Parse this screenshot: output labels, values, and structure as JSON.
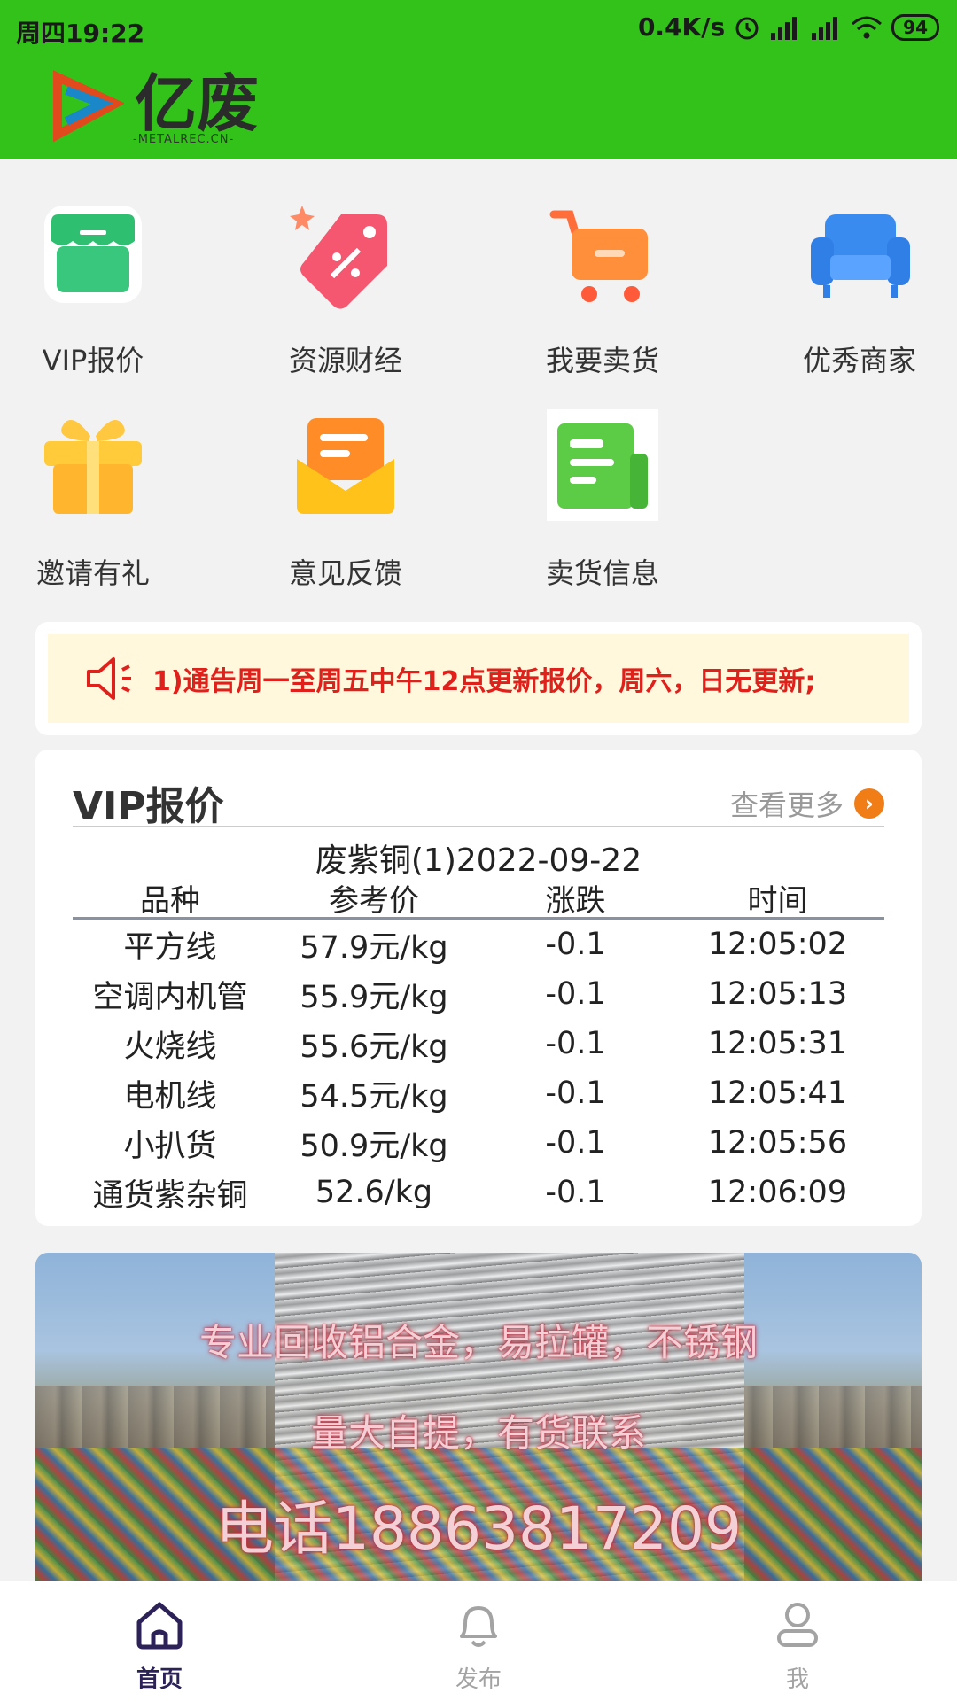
{
  "status_bar": {
    "time": "周四19:22",
    "network_speed": "0.4K/s",
    "battery": "94"
  },
  "header": {
    "brand": "亿废",
    "brand_sub": "-METALREC.CN-",
    "bg_color": "#33c21a"
  },
  "menu": [
    {
      "label": "VIP报价",
      "icon": "shop-icon"
    },
    {
      "label": "资源财经",
      "icon": "tag-icon"
    },
    {
      "label": "我要卖货",
      "icon": "cart-icon"
    },
    {
      "label": "优秀商家",
      "icon": "sofa-icon"
    },
    {
      "label": "邀请有礼",
      "icon": "gift-icon"
    },
    {
      "label": "意见反馈",
      "icon": "envelope-icon"
    },
    {
      "label": "卖货信息",
      "icon": "document-icon"
    }
  ],
  "notice": {
    "text": "1)通告周一至周五中午12点更新报价，周六，日无更新;",
    "icon": "speaker-icon"
  },
  "vip_quotes": {
    "title": "VIP报价",
    "more_label": "查看更多",
    "subtitle": "废紫铜(1)2022-09-22",
    "columns": [
      "品种",
      "参考价",
      "涨跌",
      "时间"
    ],
    "rows": [
      [
        "平方线",
        "57.9元/kg",
        "-0.1",
        "12:05:02"
      ],
      [
        "空调内机管",
        "55.9元/kg",
        "-0.1",
        "12:05:13"
      ],
      [
        "火烧线",
        "55.6元/kg",
        "-0.1",
        "12:05:31"
      ],
      [
        "电机线",
        "54.5元/kg",
        "-0.1",
        "12:05:41"
      ],
      [
        "小扒货",
        "50.9元/kg",
        "-0.1",
        "12:05:56"
      ],
      [
        "通货紫杂铜",
        "52.6/kg",
        "-0.1",
        "12:06:09"
      ]
    ]
  },
  "banner": {
    "line1": "专业回收铝合金，易拉罐，不锈钢",
    "line2": "量大自提，有货联系",
    "line3": "电话18863817209"
  },
  "tabbar": {
    "home": "首页",
    "publish": "发布",
    "me": "我",
    "active_color": "#2d2258",
    "inactive_color": "#a3a3a3"
  }
}
